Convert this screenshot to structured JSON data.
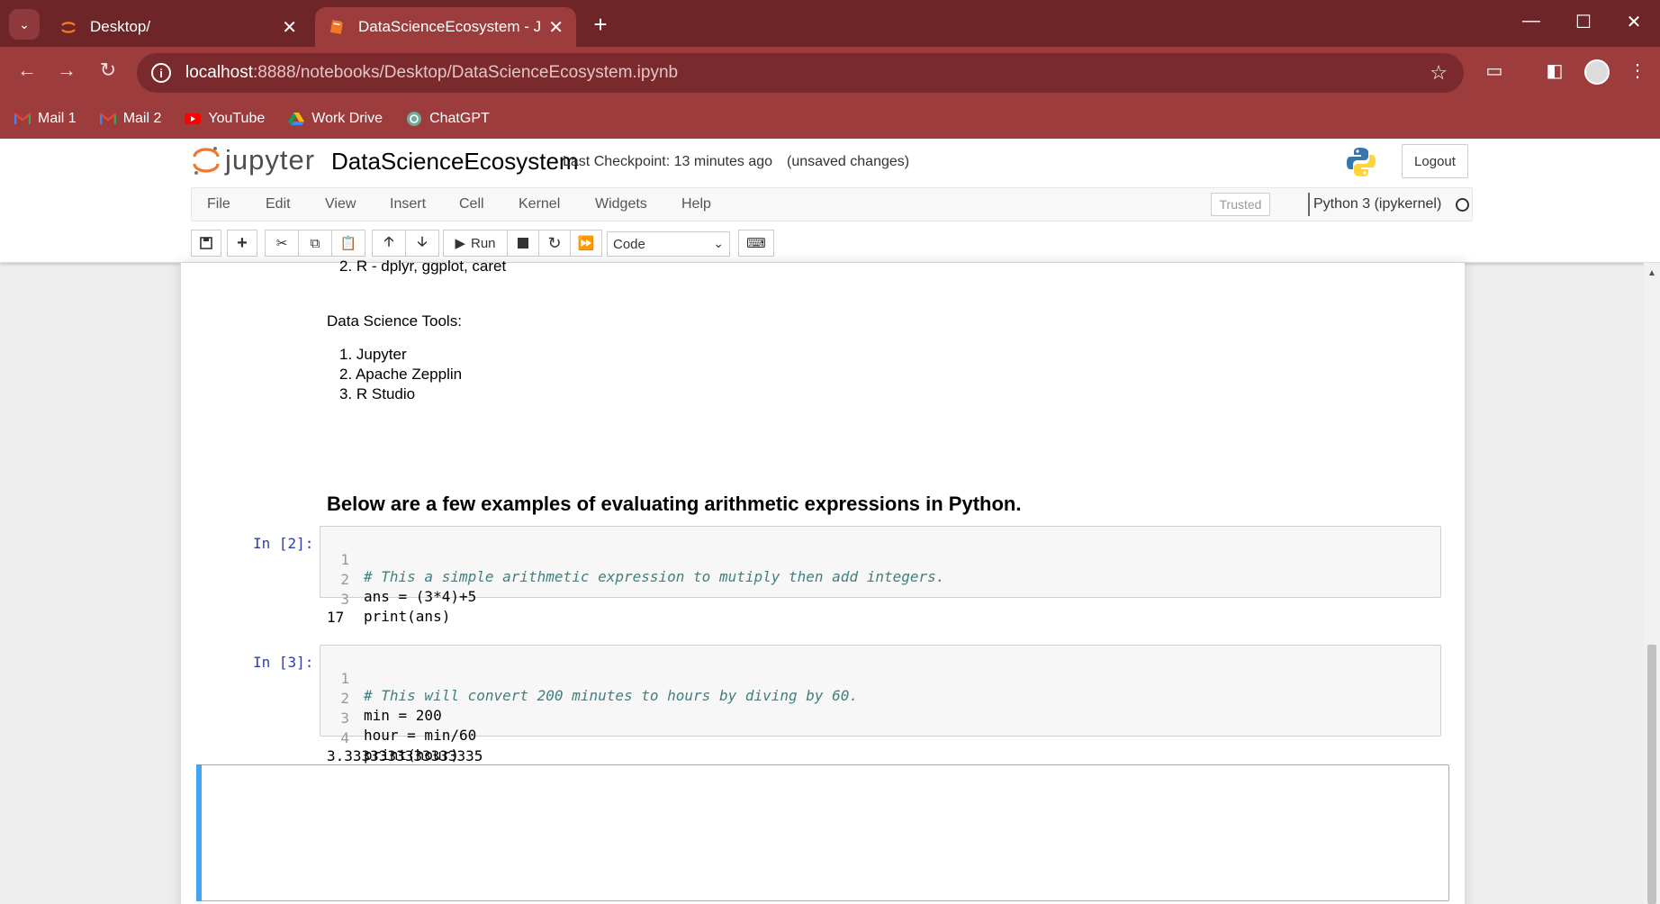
{
  "browser": {
    "tabs": [
      {
        "title": "Desktop/",
        "active": false
      },
      {
        "title": "DataScienceEcosystem - Jupyter",
        "active": true
      }
    ],
    "url_host": "localhost",
    "url_rest": ":8888/notebooks/Desktop/DataScienceEcosystem.ipynb",
    "bookmarks": [
      "Mail 1",
      "Mail 2",
      "YouTube",
      "Work Drive",
      "ChatGPT"
    ],
    "colors": {
      "frame": "#6e2528",
      "toolbar": "#9c3c3c",
      "omnibox": "#7a2a2d"
    }
  },
  "jupyter": {
    "logo_text": "jupyter",
    "notebook_name": "DataScienceEcosystem",
    "checkpoint": "Last Checkpoint: 13 minutes ago",
    "unsaved": "(unsaved changes)",
    "logout_label": "Logout",
    "menu": [
      "File",
      "Edit",
      "View",
      "Insert",
      "Cell",
      "Kernel",
      "Widgets",
      "Help"
    ],
    "trusted_label": "Trusted",
    "kernel_name": "Python 3 (ipykernel)",
    "toolbar": {
      "run_label": "Run",
      "cell_type": "Code"
    }
  },
  "cells": {
    "md_list_item_partial": "2. R - dplyr, ggplot, caret",
    "tools_heading": "Data Science Tools:",
    "tools": [
      "1. Jupyter",
      "2. Apache Zepplin",
      "3. R Studio"
    ],
    "arith_heading": "Below are a few examples of evaluating arithmetic expressions in Python.",
    "code_cells": [
      {
        "prompt": "In [2]:",
        "lines": [
          "# This a simple arithmetic expression to mutiply then add integers.",
          "ans = (3*4)+5",
          "print(ans)"
        ],
        "output": "17"
      },
      {
        "prompt": "In [3]:",
        "lines": [
          "# This will convert 200 minutes to hours by diving by 60.",
          "min = 200",
          "hour = min/60",
          "print(hour)"
        ],
        "output": "3.3333333333333335"
      }
    ]
  }
}
